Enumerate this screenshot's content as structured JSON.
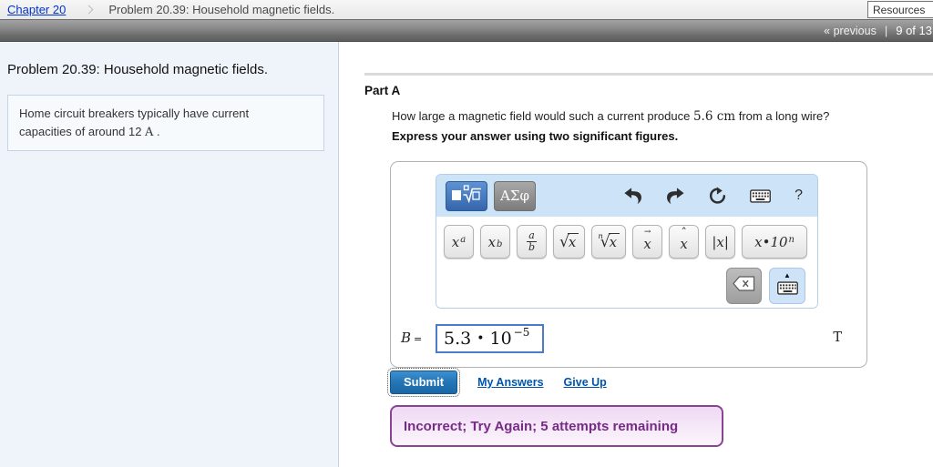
{
  "breadcrumb": {
    "chapter_link": "Chapter 20",
    "title": "Problem 20.39: Household magnetic fields.",
    "resources_label": "Resources"
  },
  "nav": {
    "previous": "« previous",
    "separator": "|",
    "position": "9 of 13"
  },
  "sidebar": {
    "title": "Problem 20.39: Household magnetic fields.",
    "intro_pre": "Home circuit breakers typically have current capacities of around 12 ",
    "intro_unit": "A",
    "intro_post": " ."
  },
  "part_a": {
    "label": "Part A",
    "question_pre": "How large a magnetic field would such a current produce ",
    "question_value": "5.6 cm",
    "question_post": " from a long wire?",
    "instruction": "Express your answer using two significant figures."
  },
  "palette": {
    "greek_label": "ΑΣφ",
    "help_glyph": "?",
    "toggle_arrow_glyph": "▲",
    "keys": [
      {
        "base": "x",
        "sup": "a"
      },
      {
        "base": "x",
        "sub": "b"
      },
      {
        "num": "a",
        "den": "b"
      },
      {
        "sign": "√",
        "radicand": "x"
      },
      {
        "index": "n",
        "sign": "√",
        "radicand": "x"
      },
      {
        "base": "x",
        "accent": "→"
      },
      {
        "base": "x",
        "accent": "ˆ"
      },
      {
        "text": "|x|"
      },
      {
        "base": "x",
        "dot": "•",
        "ten": "10",
        "sup": "n"
      }
    ]
  },
  "answer": {
    "variable": "B",
    "equals": "=",
    "mantissa": "5.3",
    "dot": "•",
    "base": "10",
    "exponent": "−5",
    "unit": "T"
  },
  "actions": {
    "submit": "Submit",
    "my_answers": "My Answers",
    "give_up": "Give Up"
  },
  "feedback": {
    "message": "Incorrect; Try Again; 5 attempts remaining"
  },
  "colors": {
    "link_blue": "#0033cc",
    "palette_header_blue": "#cde3f8",
    "selected_template_blue": "#3566ac",
    "answer_border_blue": "#4a7cc7",
    "submit_blue": "#2577b8",
    "feedback_purple_border": "#8a4494",
    "feedback_purple_text": "#762b87"
  }
}
